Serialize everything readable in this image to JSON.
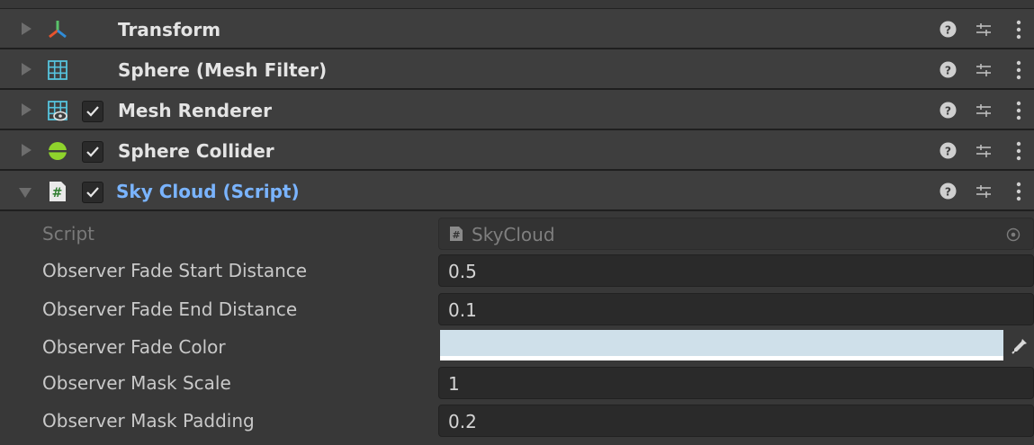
{
  "components": [
    {
      "title": "Transform",
      "icon": "transform-icon",
      "has_checkbox": false,
      "expanded": false
    },
    {
      "title": "Sphere (Mesh Filter)",
      "icon": "mesh-filter-icon",
      "has_checkbox": false,
      "expanded": false
    },
    {
      "title": "Mesh Renderer",
      "icon": "mesh-renderer-icon",
      "has_checkbox": true,
      "checked": true,
      "expanded": false
    },
    {
      "title": "Sphere Collider",
      "icon": "sphere-collider-icon",
      "has_checkbox": true,
      "checked": true,
      "expanded": false
    },
    {
      "title": "Sky Cloud (Script)",
      "icon": "script-icon",
      "has_checkbox": true,
      "checked": true,
      "expanded": true
    }
  ],
  "script_component": {
    "properties": [
      {
        "label": "Script",
        "value": "SkyCloud",
        "type": "object",
        "disabled": true
      },
      {
        "label": "Observer Fade Start Distance",
        "value": "0.5",
        "type": "float"
      },
      {
        "label": "Observer Fade End Distance",
        "value": "0.1",
        "type": "float"
      },
      {
        "label": "Observer Fade Color",
        "value": "",
        "type": "color"
      },
      {
        "label": "Observer Mask Scale",
        "value": "1",
        "type": "float"
      },
      {
        "label": "Observer Mask Padding",
        "value": "0.2",
        "type": "float"
      }
    ]
  },
  "colors": {
    "observer_fade_color": "#cfe0ea",
    "title_highlight": "#7ab4ff"
  }
}
